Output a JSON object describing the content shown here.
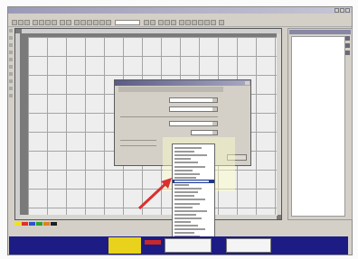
{
  "window": {
    "title": ""
  },
  "tool_palette_colors": [
    "#f0e020",
    "#e03028",
    "#3050d0",
    "#30a030",
    "#e08020",
    "#202020"
  ],
  "right_panel": {
    "first_item": ""
  },
  "dialog": {
    "title": "",
    "selected_option_index": 10
  },
  "dropdown": {
    "option_count": 28,
    "highlighted_index": 9
  },
  "colors": {
    "accent": "#1c3a8e",
    "pointer": "#d93030",
    "taskbar": "#1c1c84"
  }
}
